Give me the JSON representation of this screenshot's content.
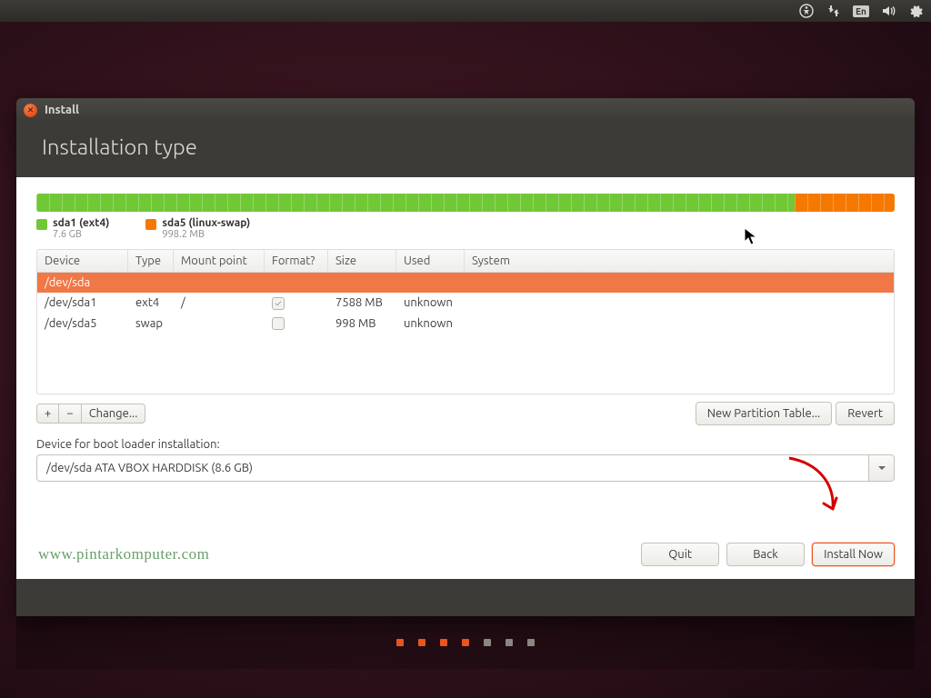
{
  "topbar": {
    "lang": "En"
  },
  "window": {
    "title": "Install",
    "page_title": "Installation type"
  },
  "disk": {
    "segments": [
      {
        "key": "sda1",
        "widthPct": 88.4,
        "color": "green",
        "legend_title": "sda1 (ext4)",
        "legend_sub": "7.6 GB"
      },
      {
        "key": "sda5",
        "widthPct": 11.6,
        "color": "orange",
        "legend_title": "sda5 (linux-swap)",
        "legend_sub": "998.2 MB"
      }
    ]
  },
  "table": {
    "headers": {
      "device": "Device",
      "type": "Type",
      "mount": "Mount point",
      "format": "Format?",
      "size": "Size",
      "used": "Used",
      "system": "System"
    },
    "disk_row": "/dev/sda",
    "rows": [
      {
        "device": "/dev/sda1",
        "type": "ext4",
        "mount": "/",
        "format": true,
        "size": "7588 MB",
        "used": "unknown",
        "system": ""
      },
      {
        "device": "/dev/sda5",
        "type": "swap",
        "mount": "",
        "format": false,
        "size": "998 MB",
        "used": "unknown",
        "system": ""
      }
    ]
  },
  "toolbar": {
    "add": "+",
    "remove": "−",
    "change": "Change...",
    "new_table": "New Partition Table...",
    "revert": "Revert"
  },
  "bootloader": {
    "label": "Device for boot loader installation:",
    "value": "/dev/sda   ATA VBOX HARDDISK (8.6 GB)"
  },
  "footer": {
    "quit": "Quit",
    "back": "Back",
    "install": "Install Now"
  },
  "watermark": "www.pintarkomputer.com"
}
